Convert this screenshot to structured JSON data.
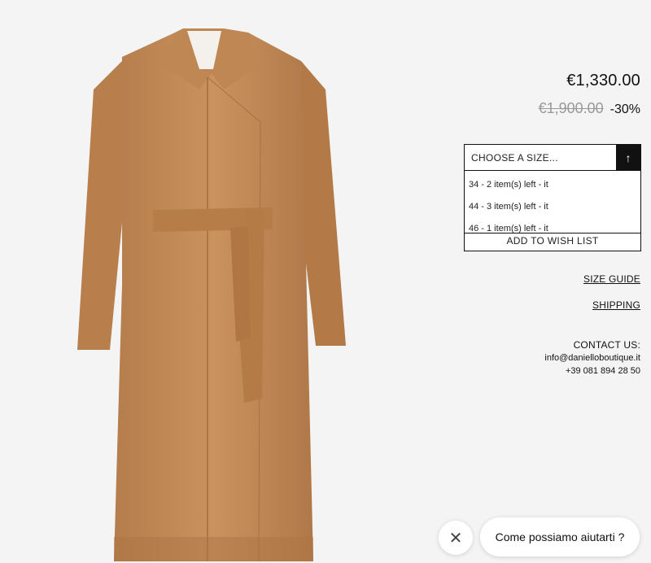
{
  "product": {
    "image_alt": "camel wool belted coat",
    "current_price": "€1,330.00",
    "old_price": "€1,900.00",
    "discount": "-30%"
  },
  "size_selector": {
    "placeholder": "CHOOSE A SIZE...",
    "options": [
      "34 - 2 item(s) left - it",
      "44 - 3 item(s) left - it",
      "46 - 1 item(s) left - it"
    ],
    "toggle_icon": "arrow-up-icon"
  },
  "actions": {
    "wishlist_label": "ADD TO WISH LIST"
  },
  "links": {
    "size_guide": "SIZE GUIDE",
    "shipping": "SHIPPING"
  },
  "contact": {
    "title": "CONTACT US:",
    "email": "info@danielloboutique.it",
    "phone": "+39 081 894 28 50"
  },
  "chat": {
    "close_icon": "close-icon",
    "prompt": "Come possiamo aiutarti ?"
  },
  "colors": {
    "background": "#f4f4f4",
    "coat": "#c28a55",
    "text": "#111111",
    "old_price": "#999999"
  }
}
